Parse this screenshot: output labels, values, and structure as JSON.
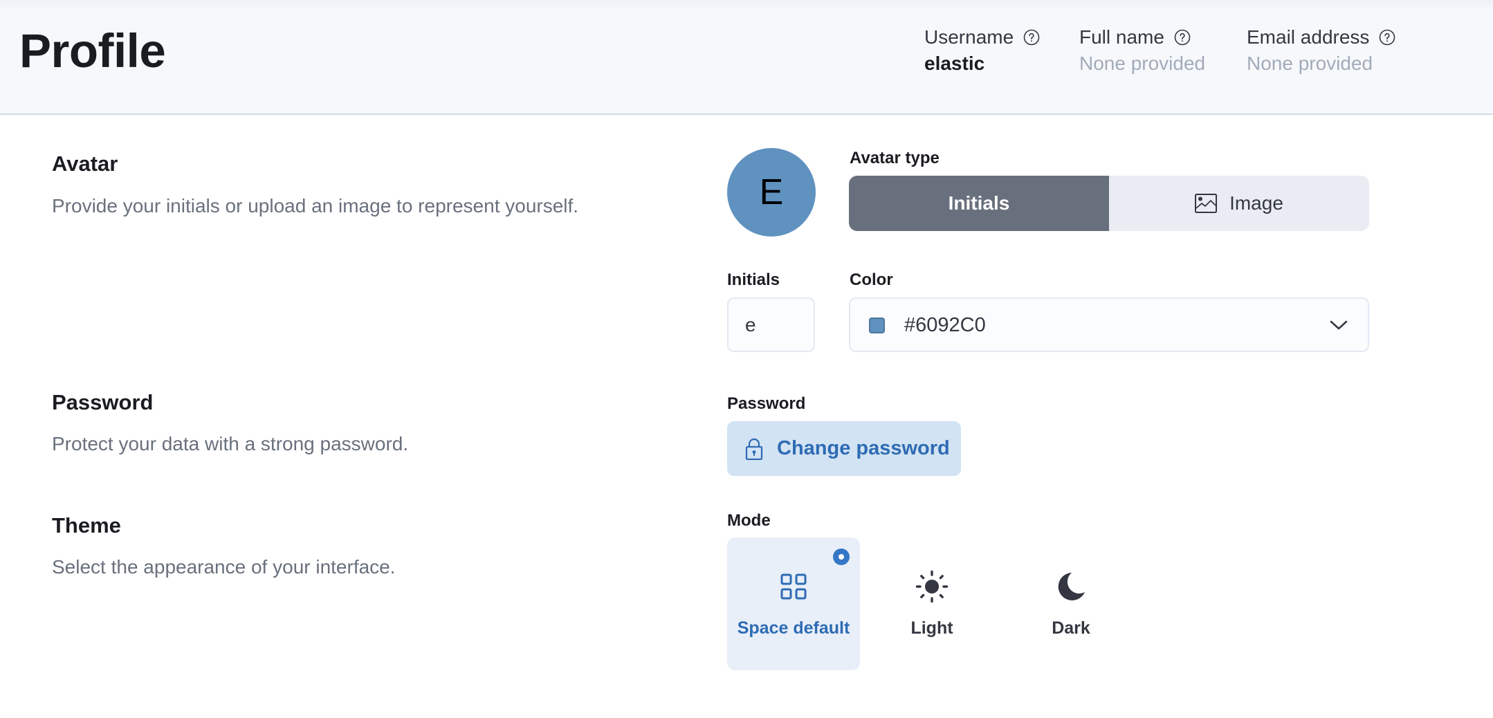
{
  "header": {
    "title": "Profile",
    "fields": [
      {
        "label": "Username",
        "value": "elastic",
        "value_style": "strong",
        "help_icon": "question-circle-icon"
      },
      {
        "label": "Full name",
        "value": "None provided",
        "value_style": "muted",
        "help_icon": "question-circle-icon"
      },
      {
        "label": "Email address",
        "value": "None provided",
        "value_style": "muted",
        "help_icon": "question-circle-icon"
      }
    ]
  },
  "sections": {
    "avatar": {
      "title": "Avatar",
      "description": "Provide your initials or upload an image to represent yourself.",
      "preview_initial": "E",
      "avatar_type_label": "Avatar type",
      "avatar_type_options": [
        {
          "label": "Initials",
          "selected": true
        },
        {
          "label": "Image",
          "selected": false,
          "icon": "image-icon"
        }
      ],
      "initials_label": "Initials",
      "initials_value": "e",
      "color_label": "Color",
      "color_value": "#6092C0",
      "color_swatch": "#6092C0"
    },
    "password": {
      "title": "Password",
      "description": "Protect your data with a strong password.",
      "field_label": "Password",
      "button_label": "Change password",
      "button_icon": "lock-icon"
    },
    "theme": {
      "title": "Theme",
      "description": "Select the appearance of your interface.",
      "mode_label": "Mode",
      "modes": [
        {
          "label": "Space default",
          "icon": "grid-icon",
          "selected": true
        },
        {
          "label": "Light",
          "icon": "sun-icon",
          "selected": false
        },
        {
          "label": "Dark",
          "icon": "moon-icon",
          "selected": false
        }
      ]
    }
  },
  "colors": {
    "accent": "#3477C6",
    "accent_text": "#2E6BB4",
    "selected_segment": "#69707D",
    "avatar_bg": "#6092C0"
  }
}
